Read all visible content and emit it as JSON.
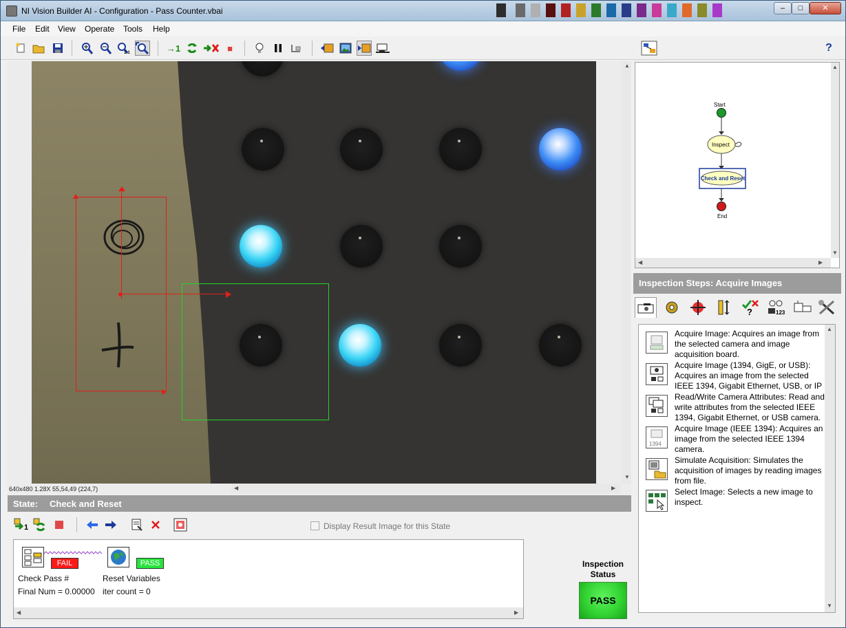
{
  "window": {
    "title": "NI Vision Builder AI - Configuration - Pass Counter.vbai",
    "min": "–",
    "max": "□",
    "close": "✕"
  },
  "menu": [
    "File",
    "Edit",
    "View",
    "Operate",
    "Tools",
    "Help"
  ],
  "toolbar": {
    "run_once": "→1",
    "stop_mark": "■",
    "help": "?"
  },
  "image": {
    "status": "640x480 1.28X 55,54,49   (224,7)"
  },
  "state": {
    "header_label": "State:",
    "header_name": "Check and Reset",
    "display_result_label": "Display Result Image for this State",
    "steps": [
      {
        "name": "Check Pass #",
        "value": "Final Num = 0.00000",
        "flag": "FAIL"
      },
      {
        "name": "Reset Variables",
        "value": "iter count = 0",
        "flag": "PASS"
      }
    ]
  },
  "inspection_status": {
    "label": "Inspection Status",
    "value": "PASS"
  },
  "flowchart": {
    "start": "Start",
    "inspect": "Inspect",
    "check_reset": "Check and Reset",
    "end": "End"
  },
  "inspection_steps": {
    "header": "Inspection Steps: Acquire Images",
    "items": [
      {
        "text": "Acquire Image:  Acquires an image from the selected camera and image acquisition board."
      },
      {
        "text": "Acquire Image (1394, GigE, or USB):  Acquires an image from the selected IEEE 1394, Gigabit Ethernet, USB, or IP camera."
      },
      {
        "text": "Read/Write Camera Attributes:  Read and write attributes from the selected IEEE 1394, Gigabit Ethernet, or USB camera."
      },
      {
        "text": "Acquire Image (IEEE 1394):  Acquires an image from the selected IEEE 1394 camera."
      },
      {
        "text": "Simulate Acquisition:  Simulates the acquisition of images by reading images from file."
      },
      {
        "text": "Select Image:  Selects a new image to inspect."
      }
    ]
  },
  "colors": {
    "fail": "#ff1a1a",
    "pass": "#27e43c",
    "roi_red": "#e0201a",
    "roi_green": "#22d42a",
    "header_gray": "#9c9c9c"
  }
}
